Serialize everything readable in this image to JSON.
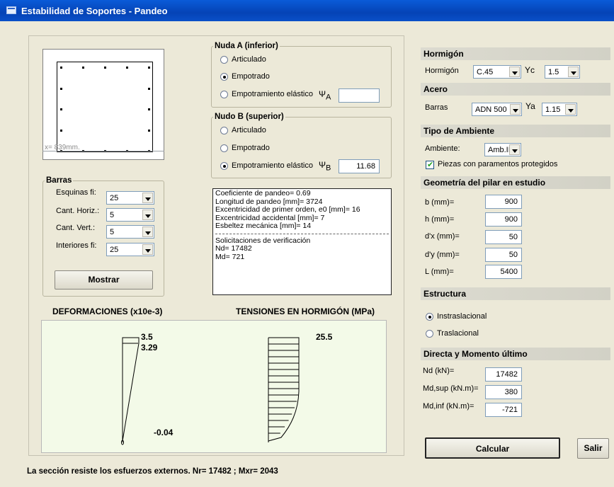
{
  "window": {
    "title": "Estabilidad de Soportes - Pandeo"
  },
  "section": {
    "x_readout": "x= 839mm."
  },
  "nudo_a": {
    "legend": "Nuda A (inferior)",
    "options": [
      "Articulado",
      "Empotrado",
      "Empotramiento elástico"
    ],
    "selected": "Empotrado",
    "psi_symbol": "Ψ",
    "psi_sub": "A",
    "psi_value": ""
  },
  "nudo_b": {
    "legend": "Nudo B (superior)",
    "options": [
      "Articulado",
      "Empotrado",
      "Empotramiento elástico"
    ],
    "selected": "Empotramiento elástico",
    "psi_symbol": "Ψ",
    "psi_sub": "B",
    "psi_value": "11.68"
  },
  "barras": {
    "legend": "Barras",
    "rows": [
      {
        "label": "Esquinas fi:",
        "value": "25"
      },
      {
        "label": "Cant. Horiz.:",
        "value": "5"
      },
      {
        "label": "Cant. Vert.:",
        "value": "5"
      },
      {
        "label": "Interiores fi:",
        "value": "25"
      }
    ],
    "mostrar_label": "Mostrar"
  },
  "results": {
    "lines": [
      "Coeficiente de pandeo= 0.69",
      "Longitud de pandeo [mm]= 3724",
      "Excentricidad de primer orden, e0 [mm]= 16",
      "Excentricidad accidental [mm]= 7",
      "Esbeltez mecánica [mm]= 14"
    ],
    "lines2": [
      "Solicitaciones de verificación",
      "Nd= 17482",
      "Md= 721"
    ]
  },
  "charts": {
    "deform_title": "DEFORMACIONES (x10e-3)",
    "tension_title": "TENSIONES EN HORMIGÓN (MPa)"
  },
  "chart_data": [
    {
      "type": "area",
      "title": "DEFORMACIONES (x10e-3)",
      "labels": [
        "3.5",
        "3.29",
        "-0.04"
      ],
      "values": {
        "top_max": 3.5,
        "top": 3.29,
        "bottom": -0.04
      }
    },
    {
      "type": "area",
      "title": "TENSIONES EN HORMIGÓN (MPa)",
      "labels": [
        "25.5"
      ],
      "values": {
        "max": 25.5
      }
    }
  ],
  "right": {
    "hormigon_header": "Hormigón",
    "hormigon_label": "Hormigón",
    "hormigon_value": "C.45",
    "yc_symbol": "Yc",
    "yc_value": "1.5",
    "acero_header": "Acero",
    "barras_label": "Barras",
    "barras_value": "ADN 500",
    "ya_symbol": "Ya",
    "ya_value": "1.15",
    "ambiente_header": "Tipo de Ambiente",
    "ambiente_label": "Ambiente:",
    "ambiente_value": "Amb.II",
    "piezas_label": "Piezas con paramentos protegidos",
    "piezas_checked": true,
    "geom_header": "Geometría del pilar en estudio",
    "geom": [
      {
        "label": "b (mm)=",
        "value": "900"
      },
      {
        "label": "h (mm)=",
        "value": "900"
      },
      {
        "label": "d'x (mm)=",
        "value": "50"
      },
      {
        "label": "d'y (mm)=",
        "value": "50"
      },
      {
        "label": "L (mm)=",
        "value": "5400"
      }
    ],
    "estructura_header": "Estructura",
    "estructura_options": [
      "Instraslacional",
      "Traslacional"
    ],
    "estructura_selected": "Instraslacional",
    "directa_header": "Directa y Momento último",
    "directa": [
      {
        "label": "Nd (kN)=",
        "value": "17482"
      },
      {
        "label": "Md,sup (kN.m)=",
        "value": "380"
      },
      {
        "label": "Md,inf (kN.m)=",
        "value": "-721"
      }
    ],
    "calcular_label": "Calcular",
    "salir_label": "Salir"
  },
  "status": {
    "text": "La sección resiste los esfuerzos externos. Nr= 17482 ; Mxr= 2043"
  }
}
